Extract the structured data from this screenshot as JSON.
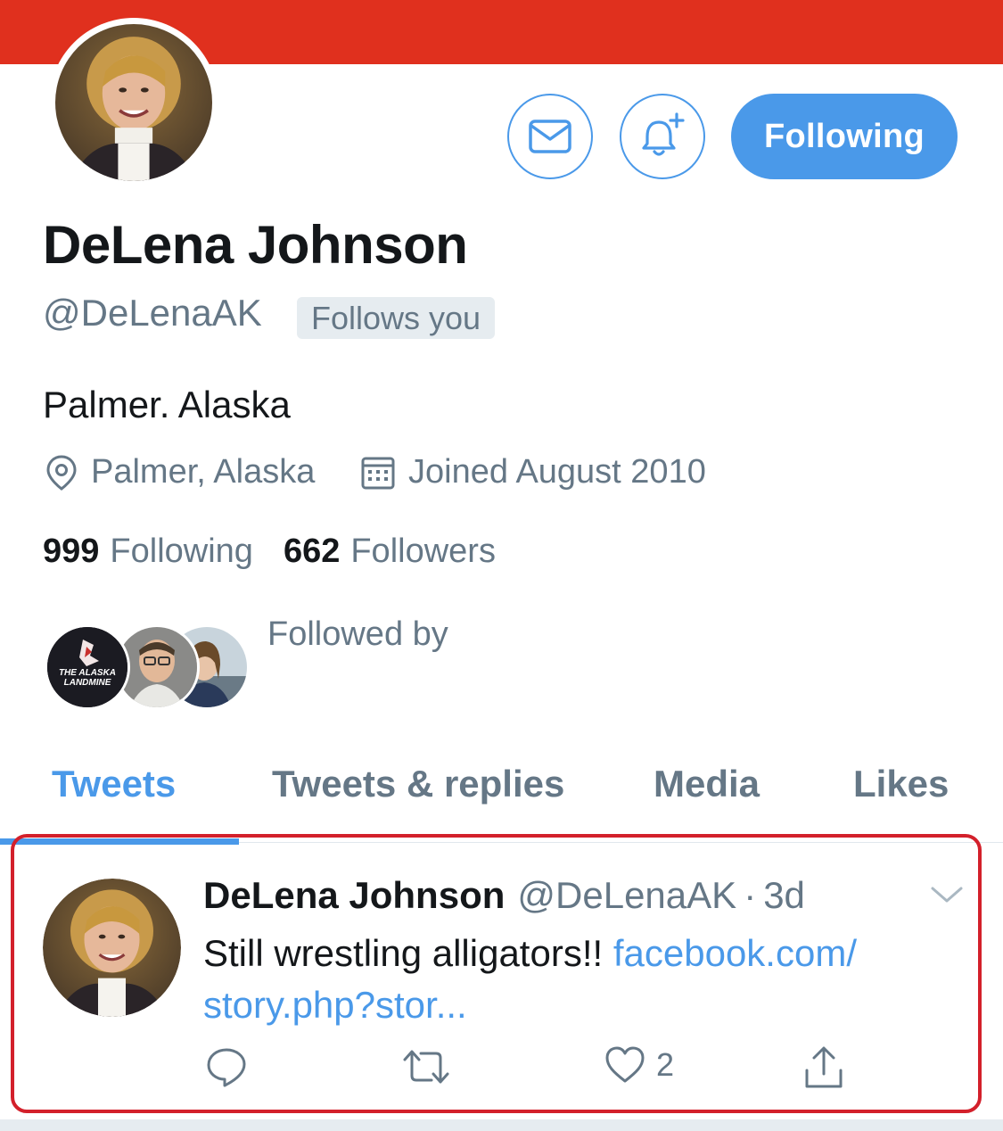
{
  "profile": {
    "name": "DeLena Johnson",
    "handle": "@DeLenaAK",
    "follows_you": "Follows you",
    "bio": "Palmer. Alaska",
    "location": "Palmer, Alaska",
    "joined": "Joined August 2010",
    "following_count": "999",
    "following_label": "Following",
    "followers_count": "662",
    "followers_label": "Followers",
    "followed_by": "Followed by",
    "follow_button": "Following",
    "followed_by_avatar_text": [
      "THE ALASKA",
      "LANDMINE"
    ]
  },
  "tabs": [
    "Tweets",
    "Tweets & replies",
    "Media",
    "Likes"
  ],
  "tweet": {
    "name": "DeLena Johnson",
    "handle": "@DeLenaAK",
    "dot": "·",
    "time": "3d",
    "text": "Still wrestling alligators!!",
    "link_part1": "facebook.com/",
    "link_part2": "story.php?stor...",
    "like_count": "2"
  },
  "colors": {
    "banner": "#e0301e",
    "accent": "#4a99e9",
    "highlight_border": "#d3202b",
    "muted_text": "#657786"
  },
  "icons": [
    "envelope-icon",
    "bell-plus-icon",
    "location-pin-icon",
    "calendar-icon",
    "chevron-down-icon",
    "reply-icon",
    "retweet-icon",
    "heart-icon",
    "share-icon"
  ]
}
